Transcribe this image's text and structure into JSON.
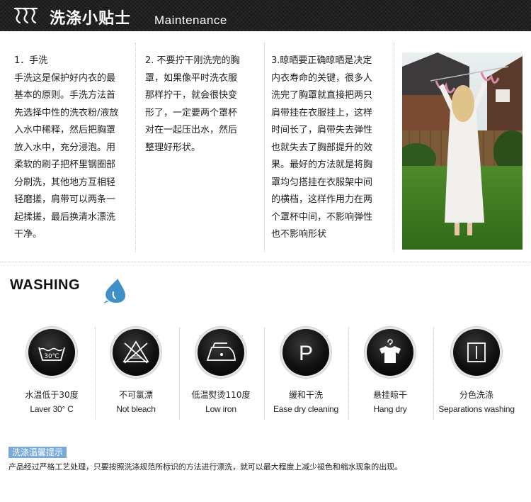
{
  "header": {
    "title": "洗涤小贴士",
    "subtitle": "Maintenance"
  },
  "tips": [
    {
      "lines": [
        "1．手洗",
        "手洗这是保护好内衣的最",
        "基本的原则。手洗方法首",
        "先选择中性的洗衣粉/液放",
        "入水中稀释，然后把胸罩",
        "放入水中，充分浸泡。用",
        "柔软的刷子把杯里钢圈部",
        "分刷洗，其他地方互相轻",
        "轻磨搓，肩带可以两条一",
        "起揉搓，最后换清水漂洗",
        "干净。"
      ]
    },
    {
      "lines": [
        "2. 不要拧干刚洗完的胸",
        "罩，如果像平时洗衣服",
        "那样拧干，就会很快变",
        "形了，一定要两个罩杯",
        "对在一起压出水，然后",
        "整理好形状。"
      ]
    },
    {
      "lines": [
        "3.晾晒要正确晾晒是决定",
        "内衣寿命的关键，很多人",
        "洗完了胸罩就直接把两只",
        "肩带挂在衣服挂上，这样",
        "时间长了，肩带失去弹性",
        "也就失去了胸部提升的效",
        "果。最好的方法就是将胸",
        "罩均匀搭挂在衣服架中间",
        "的横档，这样作用力在两",
        "个罩杯中间，不影响弹性",
        "也不影响形状"
      ]
    }
  ],
  "washing": {
    "title": "WASHING",
    "icons": [
      {
        "icon": "wash-30-icon",
        "label_zh": "水温低于30度",
        "label_en": "Laver 30° C",
        "temp": "30℃"
      },
      {
        "icon": "no-bleach-icon",
        "label_zh": "不可氯漂",
        "label_en": "Not bleach"
      },
      {
        "icon": "low-iron-icon",
        "label_zh": "低温熨烫110度",
        "label_en": "Low iron"
      },
      {
        "icon": "dry-clean-p-icon",
        "label_zh": "缓和干洗",
        "label_en": "Ease dry cleaning",
        "letter": "P"
      },
      {
        "icon": "hang-dry-icon",
        "label_zh": "悬挂晾干",
        "label_en": "Hang dry"
      },
      {
        "icon": "separate-wash-icon",
        "label_zh": "分色洗涤",
        "label_en": "Separations washing"
      }
    ]
  },
  "notice": {
    "label": "洗涤温馨提示",
    "text": "产品经过严格工艺处理，只要按照洗涤规范所标识的方法进行漂洗，就可以最大程度上减少褪色和缩水现象的出现。"
  },
  "colors": {
    "header_bg": "#1a1a1a",
    "accent_blue": "#7aa9d8",
    "drop_blue": "#3f8fc9"
  }
}
